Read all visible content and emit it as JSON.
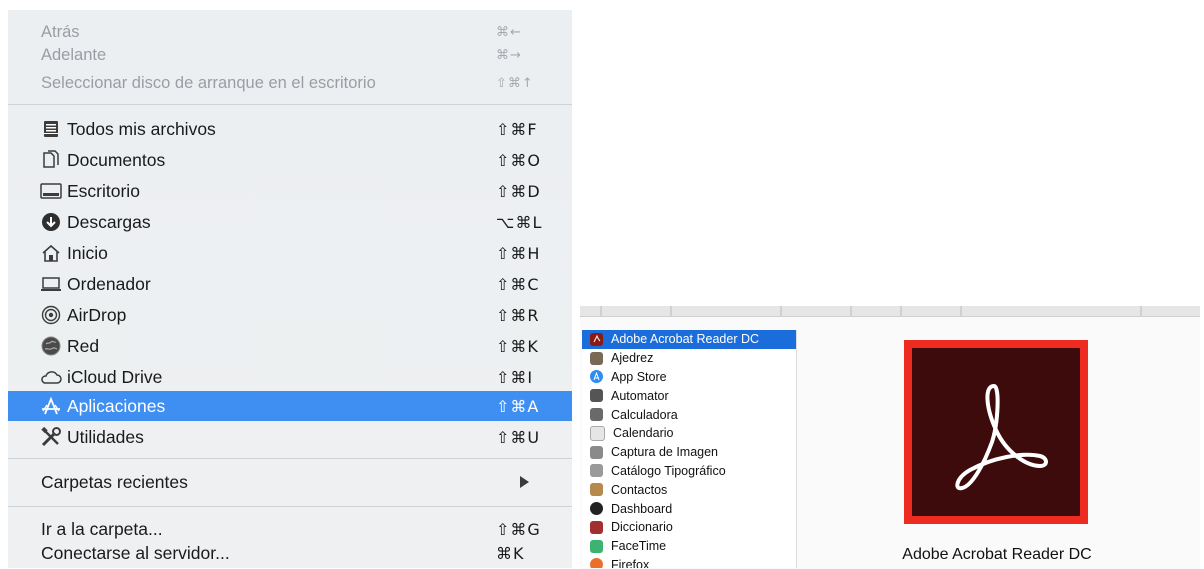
{
  "go_menu": {
    "back": {
      "label": "Atrás",
      "shortcut": "⌘←"
    },
    "forward": {
      "label": "Adelante",
      "shortcut": "⌘→"
    },
    "startup_disk": {
      "label": "Seleccionar disco de arranque en el escritorio",
      "shortcut": "⇧⌘↑"
    },
    "items": [
      {
        "label": "Todos mis archivos",
        "shortcut": "⇧⌘F",
        "icon": "all-files-icon"
      },
      {
        "label": "Documentos",
        "shortcut": "⇧⌘O",
        "icon": "documents-icon"
      },
      {
        "label": "Escritorio",
        "shortcut": "⇧⌘D",
        "icon": "desktop-icon"
      },
      {
        "label": "Descargas",
        "shortcut": "⌥⌘L",
        "icon": "downloads-icon"
      },
      {
        "label": "Inicio",
        "shortcut": "⇧⌘H",
        "icon": "home-icon"
      },
      {
        "label": "Ordenador",
        "shortcut": "⇧⌘C",
        "icon": "computer-icon"
      },
      {
        "label": "AirDrop",
        "shortcut": "⇧⌘R",
        "icon": "airdrop-icon"
      },
      {
        "label": "Red",
        "shortcut": "⇧⌘K",
        "icon": "network-icon"
      },
      {
        "label": "iCloud Drive",
        "shortcut": "⇧⌘I",
        "icon": "icloud-icon"
      },
      {
        "label": "Aplicaciones",
        "shortcut": "⇧⌘A",
        "icon": "applications-icon",
        "selected": true
      },
      {
        "label": "Utilidades",
        "shortcut": "⇧⌘U",
        "icon": "utilities-icon"
      }
    ],
    "recent_folders": {
      "label": "Carpetas recientes"
    },
    "goto_folder": {
      "label": "Ir a la carpeta...",
      "shortcut": "⇧⌘G"
    },
    "connect_server": {
      "label": "Conectarse al servidor...",
      "shortcut": "⌘K"
    }
  },
  "apps_window": {
    "apps": [
      {
        "name": "Adobe Acrobat Reader DC",
        "selected": true,
        "color": "#8b1a14"
      },
      {
        "name": "Ajedrez",
        "color": "#7a6a55"
      },
      {
        "name": "App Store",
        "color": "#2f8cf0"
      },
      {
        "name": "Automator",
        "color": "#555555"
      },
      {
        "name": "Calculadora",
        "color": "#6a6a6a"
      },
      {
        "name": "Calendario",
        "color": "#e6e6e6"
      },
      {
        "name": "Captura de Imagen",
        "color": "#8a8a8a"
      },
      {
        "name": "Catálogo Tipográfico",
        "color": "#9a9a9a"
      },
      {
        "name": "Contactos",
        "color": "#b58a4c"
      },
      {
        "name": "Dashboard",
        "color": "#222222"
      },
      {
        "name": "Diccionario",
        "color": "#a33030"
      },
      {
        "name": "FaceTime",
        "color": "#3cb371"
      },
      {
        "name": "Firefox",
        "color": "#e8702a"
      }
    ],
    "preview_caption": "Adobe Acrobat Reader DC",
    "accent": "#1b6ddb"
  },
  "colors": {
    "menu_selection": "#3f8ff3",
    "acrobat_red": "#ee2b20"
  }
}
